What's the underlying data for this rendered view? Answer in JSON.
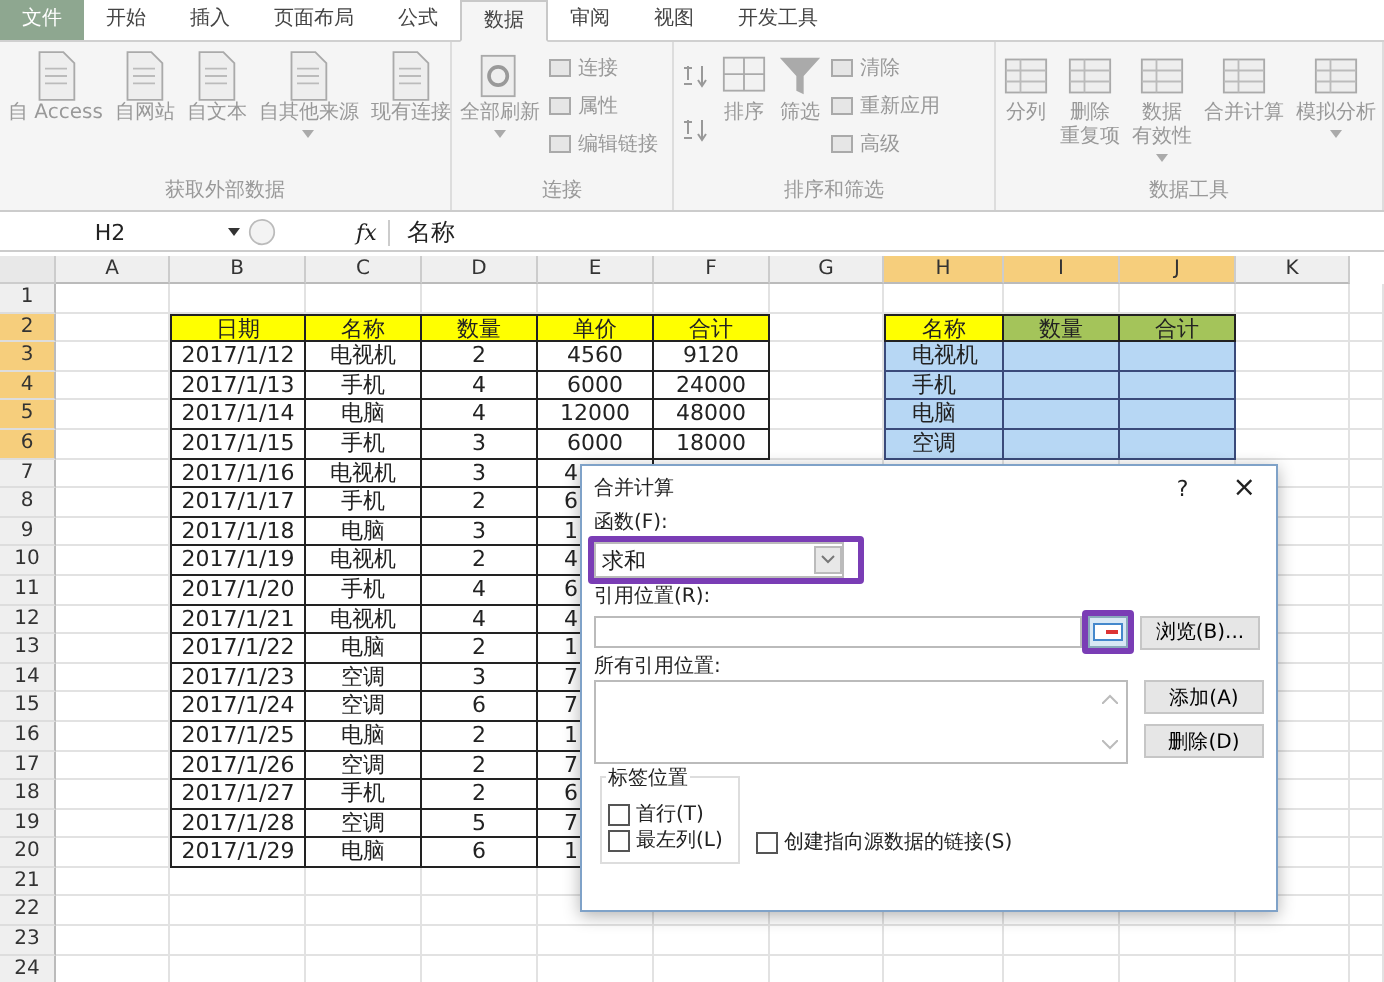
{
  "ribbon": {
    "tabs": [
      {
        "label": "文件",
        "kind": "file",
        "selected": false
      },
      {
        "label": "开始",
        "kind": "tab",
        "selected": false
      },
      {
        "label": "插入",
        "kind": "tab",
        "selected": false
      },
      {
        "label": "页面布局",
        "kind": "tab",
        "selected": false
      },
      {
        "label": "公式",
        "kind": "tab",
        "selected": false
      },
      {
        "label": "数据",
        "kind": "tab",
        "selected": true
      },
      {
        "label": "审阅",
        "kind": "tab",
        "selected": false
      },
      {
        "label": "视图",
        "kind": "tab",
        "selected": false
      },
      {
        "label": "开发工具",
        "kind": "tab",
        "selected": false
      }
    ],
    "groups": [
      {
        "label": "获取外部数据",
        "items": [
          {
            "kind": "large",
            "label": "自 Access"
          },
          {
            "kind": "large",
            "label": "自网站"
          },
          {
            "kind": "large",
            "label": "自文本"
          },
          {
            "kind": "large",
            "label": "自其他来源",
            "dropdown": true
          },
          {
            "kind": "large",
            "label": "现有连接"
          }
        ]
      },
      {
        "label": "连接",
        "items": [
          {
            "kind": "large",
            "label": "全部刷新",
            "dropdown": true
          },
          {
            "kind": "small",
            "label": "连接"
          },
          {
            "kind": "small",
            "label": "属性"
          },
          {
            "kind": "small",
            "label": "编辑链接"
          }
        ]
      },
      {
        "label": "排序和筛选",
        "items": [
          {
            "kind": "icon"
          },
          {
            "kind": "icon"
          },
          {
            "kind": "large",
            "label": "排序"
          },
          {
            "kind": "large",
            "label": "筛选"
          },
          {
            "kind": "small",
            "label": "清除"
          },
          {
            "kind": "small",
            "label": "重新应用"
          },
          {
            "kind": "small",
            "label": "高级"
          }
        ]
      },
      {
        "label": "数据工具",
        "items": [
          {
            "kind": "large",
            "label": "分列"
          },
          {
            "kind": "large",
            "lines": [
              "删除",
              "重复项"
            ]
          },
          {
            "kind": "large",
            "lines": [
              "数据",
              "有效性"
            ],
            "dropdown": true
          },
          {
            "kind": "large",
            "label": "合并计算"
          },
          {
            "kind": "large",
            "label": "模拟分析",
            "dropdown": true
          }
        ]
      }
    ]
  },
  "formula_bar": {
    "name_box": "H2",
    "function_label": "fx",
    "formula": "名称"
  },
  "sheet": {
    "columns": [
      {
        "label": "A",
        "selected": false
      },
      {
        "label": "B",
        "selected": false
      },
      {
        "label": "C",
        "selected": false
      },
      {
        "label": "D",
        "selected": false
      },
      {
        "label": "E",
        "selected": false
      },
      {
        "label": "F",
        "selected": false
      },
      {
        "label": "G",
        "selected": false
      },
      {
        "label": "H",
        "selected": true
      },
      {
        "label": "I",
        "selected": true
      },
      {
        "label": "J",
        "selected": true
      },
      {
        "label": "K",
        "selected": false
      }
    ],
    "rows": [
      {
        "label": "1",
        "selected": false
      },
      {
        "label": "2",
        "selected": true
      },
      {
        "label": "3",
        "selected": true
      },
      {
        "label": "4",
        "selected": true
      },
      {
        "label": "5",
        "selected": true
      },
      {
        "label": "6",
        "selected": true
      },
      {
        "label": "7",
        "selected": false
      },
      {
        "label": "8",
        "selected": false
      },
      {
        "label": "9",
        "selected": false
      },
      {
        "label": "10",
        "selected": false
      },
      {
        "label": "11",
        "selected": false
      },
      {
        "label": "12",
        "selected": false
      },
      {
        "label": "13",
        "selected": false
      },
      {
        "label": "14",
        "selected": false
      },
      {
        "label": "15",
        "selected": false
      },
      {
        "label": "16",
        "selected": false
      },
      {
        "label": "17",
        "selected": false
      },
      {
        "label": "18",
        "selected": false
      },
      {
        "label": "19",
        "selected": false
      },
      {
        "label": "20",
        "selected": false
      },
      {
        "label": "21",
        "selected": false
      },
      {
        "label": "22",
        "selected": false
      },
      {
        "label": "23",
        "selected": false
      },
      {
        "label": "24",
        "selected": false
      }
    ],
    "tables": [
      {
        "kind": "source",
        "columns": [
          {
            "label": "日期",
            "color": "#ffff00"
          },
          {
            "label": "名称",
            "color": "#ffff00"
          },
          {
            "label": "数量",
            "color": "#ffff00"
          },
          {
            "label": "单价",
            "color": "#ffff00"
          },
          {
            "label": "合计",
            "color": "#ffff00"
          }
        ],
        "rows": [
          [
            "2017/1/12",
            "电视机",
            "2",
            "4560",
            "9120"
          ],
          [
            "2017/1/13",
            "手机",
            "4",
            "6000",
            "24000"
          ],
          [
            "2017/1/14",
            "电脑",
            "4",
            "12000",
            "48000"
          ],
          [
            "2017/1/15",
            "手机",
            "3",
            "6000",
            "18000"
          ],
          [
            "2017/1/16",
            "电视机",
            "3",
            "4"
          ],
          [
            "2017/1/17",
            "手机",
            "2",
            "6"
          ],
          [
            "2017/1/18",
            "电脑",
            "3",
            "1"
          ],
          [
            "2017/1/19",
            "电视机",
            "2",
            "4"
          ],
          [
            "2017/1/20",
            "手机",
            "4",
            "6"
          ],
          [
            "2017/1/21",
            "电视机",
            "4",
            "4"
          ],
          [
            "2017/1/22",
            "电脑",
            "2",
            "1"
          ],
          [
            "2017/1/23",
            "空调",
            "3",
            "7"
          ],
          [
            "2017/1/24",
            "空调",
            "6",
            "7"
          ],
          [
            "2017/1/25",
            "电脑",
            "2",
            "1"
          ],
          [
            "2017/1/26",
            "空调",
            "2",
            "7"
          ],
          [
            "2017/1/27",
            "手机",
            "2",
            "6"
          ],
          [
            "2017/1/28",
            "空调",
            "5",
            "7"
          ],
          [
            "2017/1/29",
            "电脑",
            "6",
            "1"
          ]
        ]
      },
      {
        "kind": "output",
        "columns": [
          {
            "label": "名称",
            "color": "#ffff00"
          },
          {
            "label": "数量",
            "color": "#a4c45a"
          },
          {
            "label": "合计",
            "color": "#a4c45a"
          }
        ],
        "rows": [
          [
            "电视机"
          ],
          [
            "手机"
          ],
          [
            "电脑"
          ],
          [
            "空调"
          ]
        ]
      }
    ]
  },
  "dialog": {
    "title": "合并计算",
    "help": "?",
    "close": "×",
    "function_label": "函数(F):",
    "function_value": "求和",
    "function_highlighted": true,
    "reference_label": "引用位置(R):",
    "reference_button_highlighted": true,
    "browse_button": "浏览(B)...",
    "all_references_label": "所有引用位置:",
    "add_button": "添加(A)",
    "delete_button": "删除(D)",
    "label_group": "标签位置",
    "checkboxes": [
      {
        "label": "首行(T)",
        "checked": false
      },
      {
        "label": "最左列(L)",
        "checked": false
      },
      {
        "label": "创建指向源数据的链接(S)",
        "checked": false
      }
    ]
  }
}
